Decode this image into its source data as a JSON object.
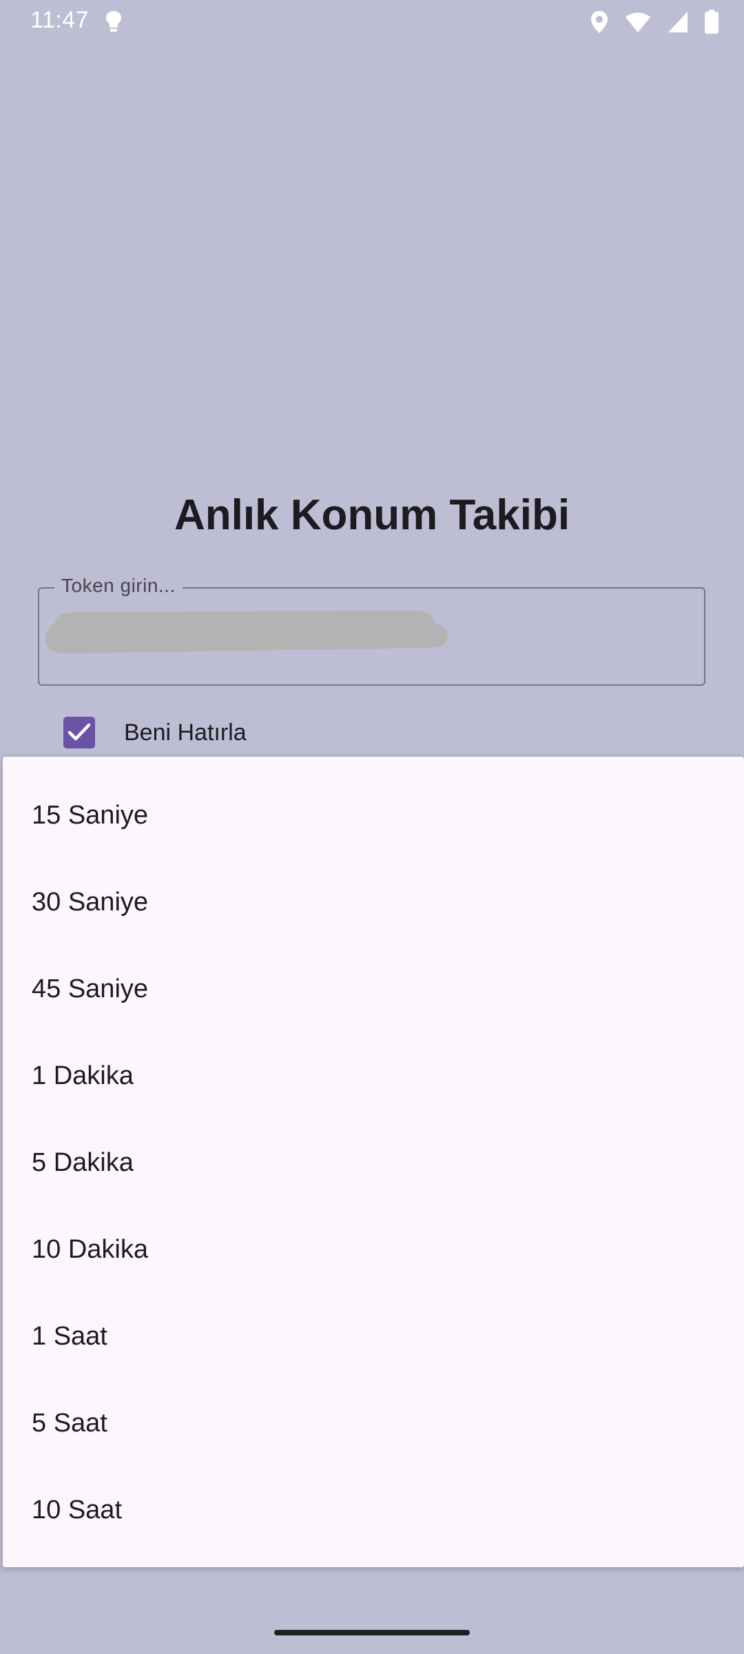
{
  "status_bar": {
    "time": "11:47",
    "left_icon": "lightbulb-icon",
    "right_icons": [
      "location-icon",
      "wifi-icon",
      "signal-icon",
      "battery-icon"
    ]
  },
  "app": {
    "title": "Anlık Konum Takibi",
    "token_field": {
      "label": "Token girin...",
      "value_redacted": true
    },
    "remember_me": {
      "label": "Beni Hatırla",
      "checked": true
    }
  },
  "dropdown": {
    "options": [
      "15 Saniye",
      "30 Saniye",
      "45 Saniye",
      "1 Dakika",
      "5 Dakika",
      "10 Dakika",
      "1 Saat",
      "5 Saat",
      "10 Saat"
    ]
  },
  "colors": {
    "scrim_background": "#bdbdd3",
    "menu_background": "#fdf7fd",
    "accent": "#6a53a4",
    "text": "#1d1b20"
  }
}
